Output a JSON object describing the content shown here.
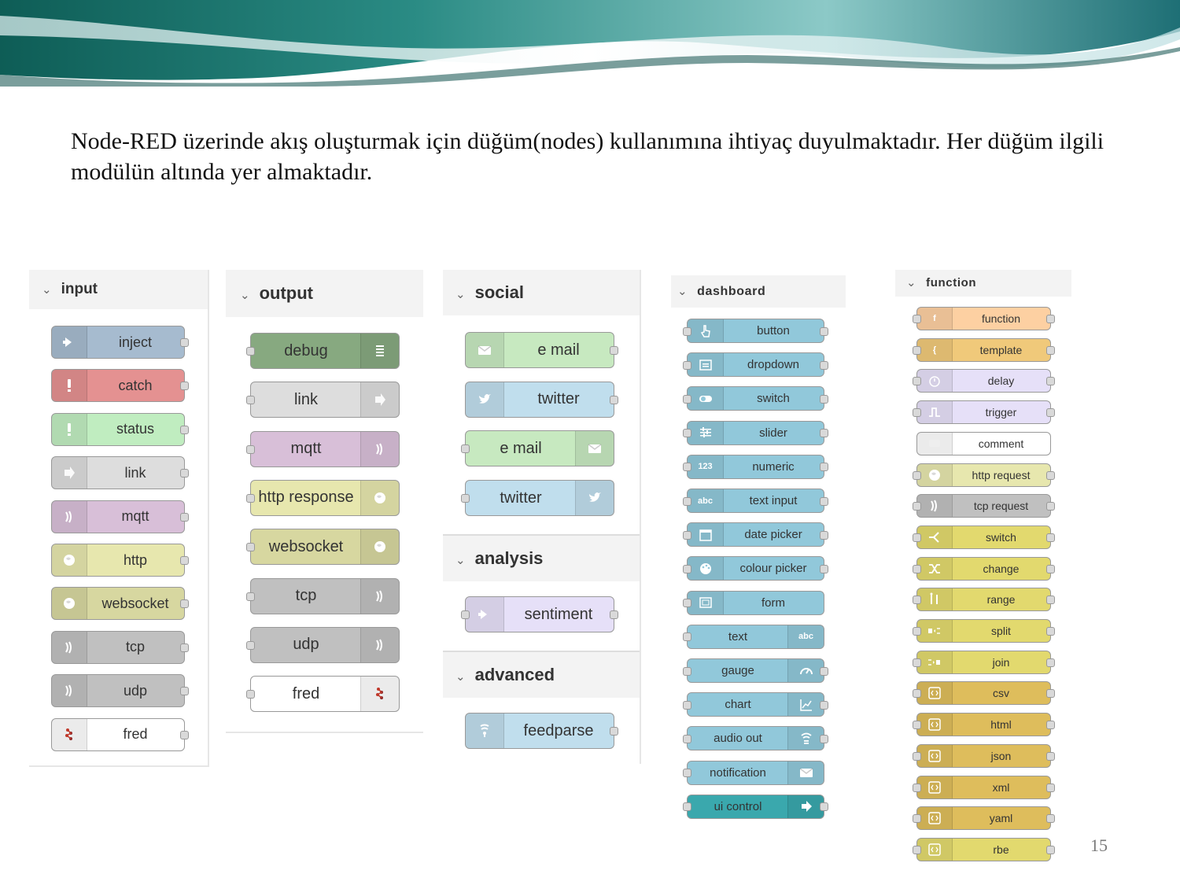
{
  "slide": {
    "text": "Node-RED üzerinde akış oluşturmak için düğüm(nodes) kullanımına ihtiyaç duyulmaktadır.  Her düğüm ilgili modülün altında yer almaktadır.",
    "page_number": "15"
  },
  "input": {
    "header": "input",
    "nodes": [
      {
        "label": "inject",
        "color": "#a6bbcf",
        "icon": "arrow-in-icon"
      },
      {
        "label": "catch",
        "color": "#e49191",
        "icon": "exclamation-icon"
      },
      {
        "label": "status",
        "color": "#c0edc0",
        "icon": "exclamation-icon"
      },
      {
        "label": "link",
        "color": "#dddddd",
        "icon": "link-arrow-icon"
      },
      {
        "label": "mqtt",
        "color": "#d8bfd8",
        "icon": "bridge-icon"
      },
      {
        "label": "http",
        "color": "#e7e7ae",
        "icon": "globe-icon"
      },
      {
        "label": "websocket",
        "color": "#d7d7a0",
        "icon": "globe-icon"
      },
      {
        "label": "tcp",
        "color": "#c0c0c0",
        "icon": "bridge-icon"
      },
      {
        "label": "udp",
        "color": "#c0c0c0",
        "icon": "bridge-icon"
      },
      {
        "label": "fred",
        "color": "#ffffff",
        "icon": "fred-logo-icon"
      }
    ]
  },
  "output": {
    "header": "output",
    "nodes": [
      {
        "label": "debug",
        "color": "#87a980",
        "icon": "list-icon"
      },
      {
        "label": "link",
        "color": "#dddddd",
        "icon": "link-arrow-icon"
      },
      {
        "label": "mqtt",
        "color": "#d8bfd8",
        "icon": "bridge-icon"
      },
      {
        "label": "http response",
        "color": "#e7e7ae",
        "icon": "globe-icon"
      },
      {
        "label": "websocket",
        "color": "#d7d7a0",
        "icon": "globe-icon"
      },
      {
        "label": "tcp",
        "color": "#c0c0c0",
        "icon": "bridge-icon"
      },
      {
        "label": "udp",
        "color": "#c0c0c0",
        "icon": "bridge-icon"
      },
      {
        "label": "fred",
        "color": "#ffffff",
        "icon": "fred-logo-icon"
      }
    ]
  },
  "social": {
    "header": "social",
    "nodes": [
      {
        "label": "e mail",
        "color": "#c7e9c0",
        "icon": "envelope-icon"
      },
      {
        "label": "twitter",
        "color": "#c0deed",
        "icon": "twitter-bird-icon"
      },
      {
        "label": "e mail",
        "color": "#c7e9c0",
        "icon": "envelope-icon"
      },
      {
        "label": "twitter",
        "color": "#c0deed",
        "icon": "twitter-bird-icon"
      }
    ]
  },
  "analysis": {
    "header": "analysis",
    "nodes": [
      {
        "label": "sentiment",
        "color": "#e6e0f8",
        "icon": "arrow-in-icon"
      }
    ]
  },
  "advanced": {
    "header": "advanced",
    "nodes": [
      {
        "label": "feedparse",
        "color": "#c0deed",
        "icon": "feed-icon"
      }
    ]
  },
  "dashboard": {
    "header": "dashboard",
    "color": "#91c8da",
    "nodes": [
      {
        "label": "button",
        "icon": "hand-pointer-icon"
      },
      {
        "label": "dropdown",
        "icon": "list-box-icon"
      },
      {
        "label": "switch",
        "icon": "toggle-icon"
      },
      {
        "label": "slider",
        "icon": "sliders-icon"
      },
      {
        "label": "numeric",
        "icon": "numeric-icon",
        "icon_text": "123"
      },
      {
        "label": "text input",
        "icon": "text-input-icon",
        "icon_text": "abc"
      },
      {
        "label": "date picker",
        "icon": "calendar-icon"
      },
      {
        "label": "colour picker",
        "icon": "palette-icon"
      },
      {
        "label": "form",
        "icon": "form-icon"
      },
      {
        "label": "text",
        "icon": "text-icon",
        "icon_text": "abc"
      },
      {
        "label": "gauge",
        "icon": "gauge-icon"
      },
      {
        "label": "chart",
        "icon": "line-chart-icon"
      },
      {
        "label": "audio out",
        "icon": "audio-icon"
      },
      {
        "label": "notification",
        "icon": "envelope-icon"
      },
      {
        "label": "ui control",
        "icon": "arrow-right-icon"
      }
    ]
  },
  "function": {
    "header": "function",
    "nodes": [
      {
        "label": "function",
        "color": "#fdd0a2",
        "icon": "function-icon",
        "icon_text": "f"
      },
      {
        "label": "template",
        "color": "#f0c97a",
        "icon": "template-icon",
        "icon_text": "{"
      },
      {
        "label": "delay",
        "color": "#e6e0f8",
        "icon": "timer-icon"
      },
      {
        "label": "trigger",
        "color": "#e6e0f8",
        "icon": "trigger-icon"
      },
      {
        "label": "comment",
        "color": "#ffffff",
        "icon": "comment-icon"
      },
      {
        "label": "http request",
        "color": "#e7e7ae",
        "icon": "globe-icon"
      },
      {
        "label": "tcp request",
        "color": "#c0c0c0",
        "icon": "bridge-icon"
      },
      {
        "label": "switch",
        "color": "#e2d96e",
        "icon": "switch-icon"
      },
      {
        "label": "change",
        "color": "#e2d96e",
        "icon": "shuffle-icon"
      },
      {
        "label": "range",
        "color": "#e2d96e",
        "icon": "range-icon"
      },
      {
        "label": "split",
        "color": "#e2d96e",
        "icon": "split-icon"
      },
      {
        "label": "join",
        "color": "#e2d96e",
        "icon": "join-icon"
      },
      {
        "label": "csv",
        "color": "#debd5c",
        "icon": "csv-icon"
      },
      {
        "label": "html",
        "color": "#debd5c",
        "icon": "code-icon"
      },
      {
        "label": "json",
        "color": "#debd5c",
        "icon": "braces-icon"
      },
      {
        "label": "xml",
        "color": "#debd5c",
        "icon": "code-icon"
      },
      {
        "label": "yaml",
        "color": "#debd5c",
        "icon": "yaml-icon"
      },
      {
        "label": "rbe",
        "color": "#e2d96e",
        "icon": "rbe-icon"
      }
    ]
  }
}
